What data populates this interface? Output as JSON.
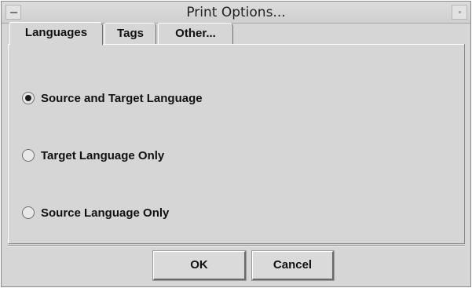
{
  "window": {
    "title": "Print Options..."
  },
  "tabs": [
    {
      "label": "Languages",
      "active": true
    },
    {
      "label": "Tags",
      "active": false
    },
    {
      "label": "Other...",
      "active": false
    }
  ],
  "options": [
    {
      "label": "Source and Target Language",
      "selected": true
    },
    {
      "label": "Target Language Only",
      "selected": false
    },
    {
      "label": "Source Language Only",
      "selected": false
    }
  ],
  "buttons": {
    "ok": "OK",
    "cancel": "Cancel"
  },
  "icons": {
    "window_menu": "window-menu-icon",
    "maximize": "maximize-icon"
  }
}
